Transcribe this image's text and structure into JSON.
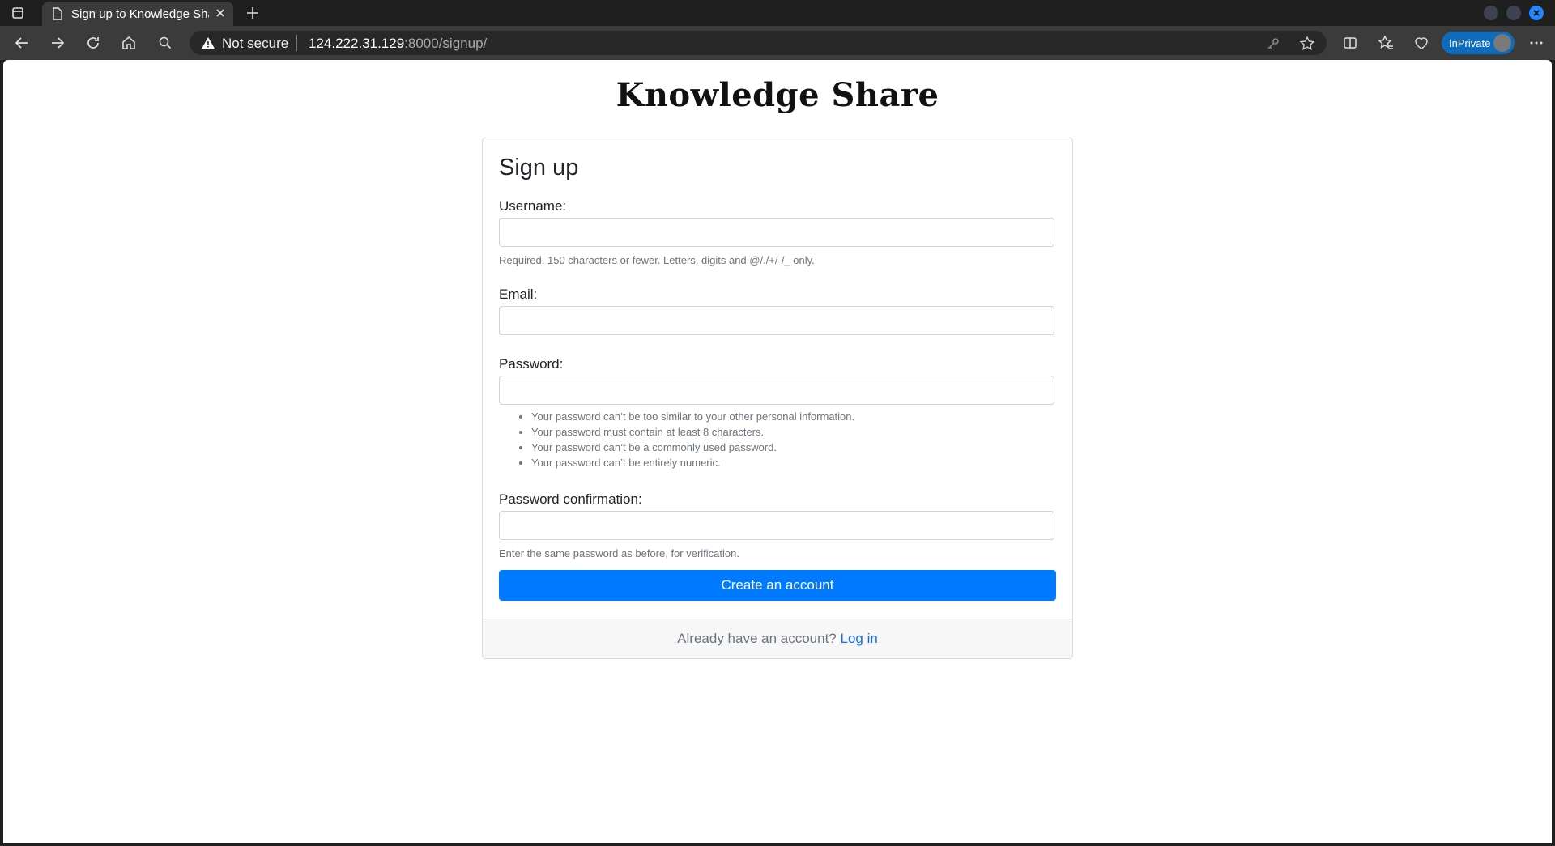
{
  "browser": {
    "tab_title": "Sign up to Knowledge Sha",
    "security_label": "Not secure",
    "url_host": "124.222.31.129",
    "url_rest": ":8000/signup/",
    "inprivate_label": "InPrivate"
  },
  "page": {
    "brand": "Knowledge Share",
    "heading": "Sign up",
    "username_label": "Username:",
    "username_help": "Required. 150 characters or fewer. Letters, digits and @/./+/-/_ only.",
    "email_label": "Email:",
    "password_label": "Password:",
    "password_rules": [
      "Your password can’t be too similar to your other personal information.",
      "Your password must contain at least 8 characters.",
      "Your password can’t be a commonly used password.",
      "Your password can’t be entirely numeric."
    ],
    "password_confirm_label": "Password confirmation:",
    "password_confirm_help": "Enter the same password as before, for verification.",
    "submit_label": "Create an account",
    "footer_text": "Already have an account?",
    "login_link": "Log in"
  },
  "colors": {
    "primary": "#007bff",
    "link": "#0d6efd",
    "chrome_dark": "#1f1f1f",
    "chrome_toolbar": "#3b3b3b",
    "inprivate": "#0f6cbd"
  },
  "icons": [
    "sidebar-toggle-icon",
    "document-icon",
    "close-icon",
    "plus-icon",
    "back-icon",
    "forward-icon",
    "refresh-icon",
    "home-icon",
    "search-icon",
    "warning-icon",
    "key-icon",
    "star-icon",
    "split-screen-icon",
    "favorites-icon",
    "extensions-icon",
    "more-icon"
  ]
}
